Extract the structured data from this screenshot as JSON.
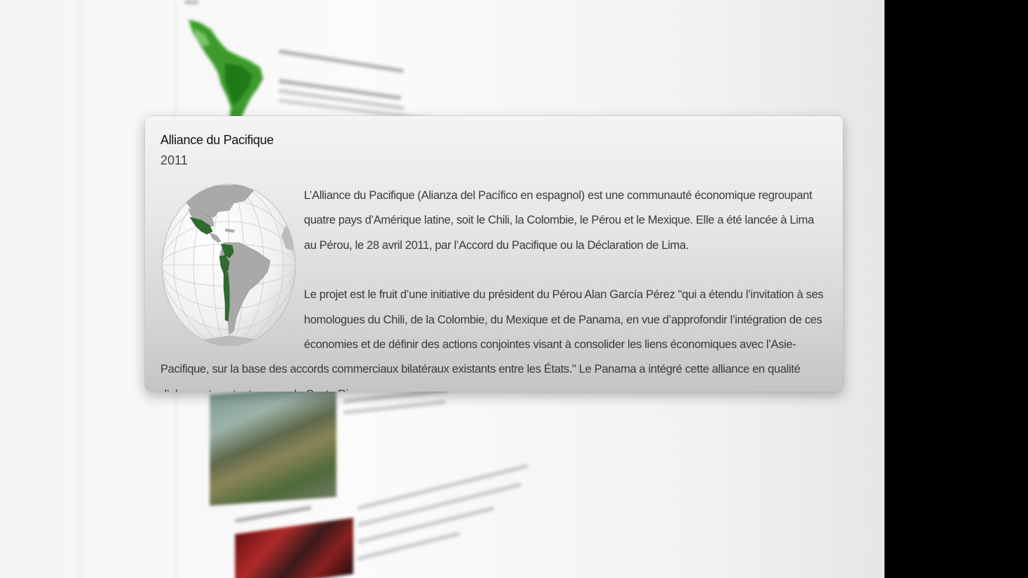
{
  "popup": {
    "title": "Alliance du Pacifique",
    "year": "2011",
    "paragraphs": [
      "L’Alliance du Pacifique (Alianza del Pacífico en espagnol) est une communauté économique regroupant quatre pays d’Amérique latine, soit le Chili, la Colombie, le Pérou et le Mexique. Elle a été lancée à Lima au Pérou, le 28 avril 2011, par l’Accord du Pacifique ou la Déclaration de Lima.",
      "Le projet est le fruit d’une initiative du président du Pérou Alan García Pérez \"qui a étendu l’invitation à ses homologues du Chili, de la Colombie, du Mexique et de Panama, en vue d’approfondir l’intégration de ces économies et de définir des actions conjointes visant à consolider les liens économiques avec l’Asie-Pacifique, sur la base des accords commerciaux bilatéraux existants entre les États.\" Le Panama a intégré cette alliance en qualité d’observateur, tout comme le Costa Rica."
    ],
    "globe_icon": "globe-americas-map",
    "highlight_color": "#2f6b2f"
  },
  "colors": {
    "popup_top": "#f4f4f4",
    "popup_bottom": "#c4c4c4",
    "background": "#f4f4f4",
    "map_green": "#2e8b2e"
  }
}
